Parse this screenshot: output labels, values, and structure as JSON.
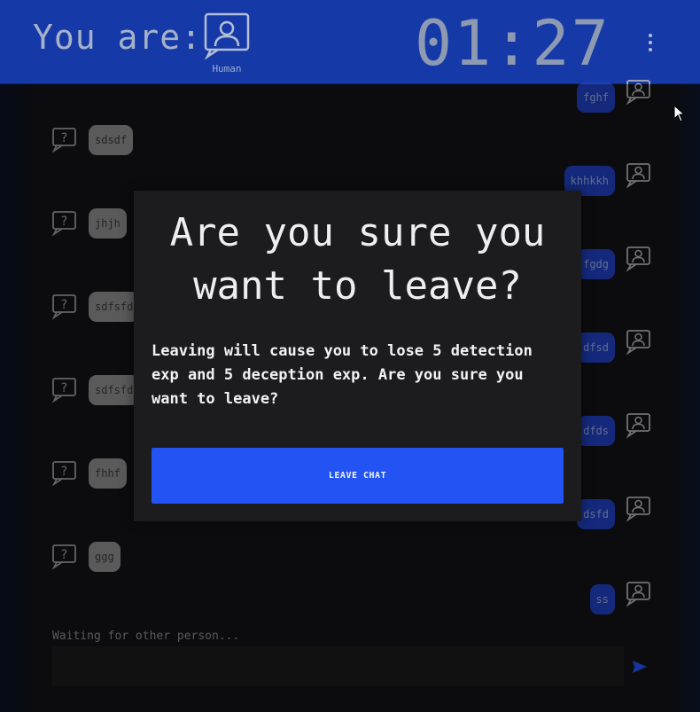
{
  "header": {
    "you_are_label": "You are:",
    "role_icon": "person-icon",
    "role_label": "Human",
    "timer": "01:27",
    "menu_icon": "kebab-menu-icon",
    "background_color": "#1639a8"
  },
  "chat": {
    "messages": [
      {
        "side": "out",
        "text": "fghf"
      },
      {
        "side": "in",
        "text": "sdsdf"
      },
      {
        "side": "out",
        "text": "khhkkh"
      },
      {
        "side": "in",
        "text": "jhjh"
      },
      {
        "side": "out",
        "text": "fgdg"
      },
      {
        "side": "in",
        "text": "sdfsfd"
      },
      {
        "side": "out",
        "text": "dfsd"
      },
      {
        "side": "in",
        "text": "sdfsfd"
      },
      {
        "side": "out",
        "text": "dfds"
      },
      {
        "side": "in",
        "text": "fhhf"
      },
      {
        "side": "out",
        "text": "dsfd"
      },
      {
        "side": "in",
        "text": "ggg"
      },
      {
        "side": "out",
        "text": "ss"
      }
    ],
    "incoming_icon": "question-bubble-icon",
    "outgoing_icon": "person-icon",
    "incoming_color": "#8a8a8a",
    "outgoing_color": "#1f3fbf"
  },
  "status": {
    "waiting_text": "Waiting for other person..."
  },
  "composer": {
    "input_value": "",
    "send_icon": "send-arrow-icon"
  },
  "modal": {
    "title": "Are you sure you want to leave?",
    "body": "Leaving will cause you to lose 5 detection exp and 5 deception exp. Are you sure you want to leave?",
    "leave_button_label": "LEAVE CHAT",
    "button_color": "#2353f3"
  }
}
